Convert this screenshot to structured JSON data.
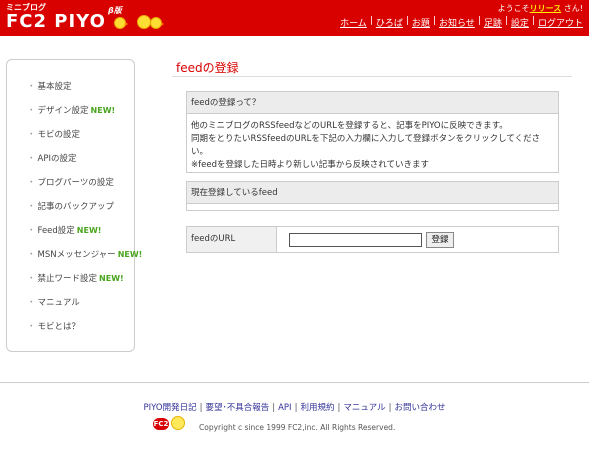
{
  "header": {
    "logo_small": "ミニブログ",
    "logo_main": "FC2 PIYO",
    "logo_beta": "β版",
    "welcome_prefix": "ようこそ",
    "welcome_user": "リリース",
    "welcome_suffix": "さん!",
    "nav": [
      {
        "label": "ホーム"
      },
      {
        "label": "ひろば"
      },
      {
        "label": "お題"
      },
      {
        "label": "お知らせ"
      },
      {
        "label": "足跡"
      },
      {
        "label": "設定"
      },
      {
        "label": "ログアウト"
      }
    ],
    "nav_separator": "|"
  },
  "sidebar": {
    "bullet": "・",
    "new_badge": "NEW!",
    "items": [
      {
        "label": "基本設定"
      },
      {
        "label": "デザイン設定"
      },
      {
        "label": "モビの設定"
      },
      {
        "label": "APIの設定"
      },
      {
        "label": "ブログパーツの設定"
      },
      {
        "label": "記事のバックアップ"
      },
      {
        "label": "Feed設定"
      },
      {
        "label": "MSNメッセンジャー"
      },
      {
        "label": "禁止ワード設定"
      },
      {
        "label": "マニュアル"
      },
      {
        "label": "モビとは？"
      }
    ]
  },
  "main": {
    "title": "feedの登録",
    "about": {
      "heading": "feedの登録って？",
      "lines": [
        "他のミニブログのRSSfeedなどのURLを登録すると、記事をPIYOに反映できます。",
        "同期をとりたいRSSfeedのURLを下記の入力欄に入力して登録ボタンをクリックしてください。",
        "※feedを登録した日時より新しい記事から反映されていきます"
      ]
    },
    "registered": {
      "heading": "現在登録しているfeed"
    },
    "form": {
      "label": "feedのURL",
      "input_value": "",
      "button": "登録"
    }
  },
  "footer": {
    "links": [
      {
        "label": "PIYO開発日記"
      },
      {
        "label": "要望･不具合報告"
      },
      {
        "label": "API"
      },
      {
        "label": "利用規約"
      },
      {
        "label": "マニュアル"
      },
      {
        "label": "お問い合わせ"
      }
    ],
    "separator": "|",
    "badge": "FC2",
    "copyright": "Copyright c since 1999 FC2,inc. All Rights Reserved."
  },
  "colors": {
    "header_bg": "#d90000",
    "title": "#d90000",
    "new_badge": "#4aa51f",
    "username": "#ffee00",
    "footer_link": "#333399"
  }
}
